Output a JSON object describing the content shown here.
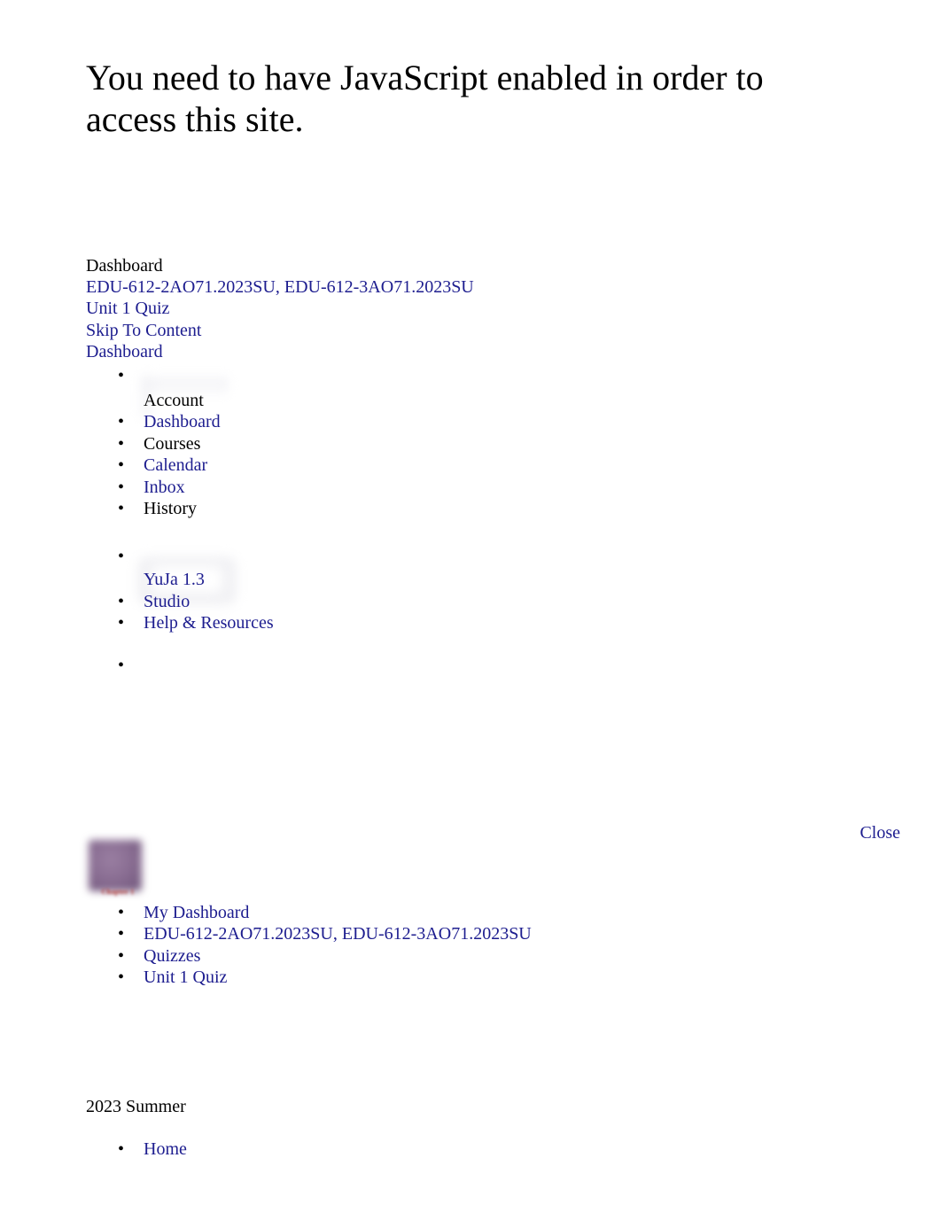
{
  "noscript": {
    "message": "You need to have JavaScript enabled in order to access this site."
  },
  "top_links": {
    "page_label": "Dashboard",
    "course_link": "EDU-612-2AO71.2023SU, EDU-612-3AO71.2023SU",
    "quiz_link": "Unit 1 Quiz",
    "skip_to_content": "Skip To Content",
    "dashboard_link": "Dashboard"
  },
  "global_nav": {
    "items": [
      {
        "label": "Account",
        "is_link": false,
        "has_image": true,
        "image": "account-avatar-placeholder"
      },
      {
        "label": "Dashboard",
        "is_link": true,
        "has_image": false
      },
      {
        "label": "Courses",
        "is_link": false,
        "has_image": false
      },
      {
        "label": "Calendar",
        "is_link": true,
        "has_image": false
      },
      {
        "label": "Inbox",
        "is_link": true,
        "has_image": false
      },
      {
        "label": "History",
        "is_link": false,
        "has_image": false
      },
      {
        "label": "YuJa 1.3",
        "is_link": true,
        "has_image": true,
        "image": "yuja-logo-placeholder"
      },
      {
        "label": "Studio",
        "is_link": true,
        "has_image": false
      },
      {
        "label": "Help & Resources",
        "is_link": true,
        "has_image": false
      },
      {
        "label": "",
        "is_link": false,
        "has_image": false
      }
    ]
  },
  "tray": {
    "close_label": "Close"
  },
  "course_card": {
    "thumbnail_caption": "Chapter 1",
    "thumbnail_color": "#8a6e93",
    "caption_color": "#b3322b"
  },
  "breadcrumb": {
    "items": [
      "My Dashboard",
      "EDU-612-2AO71.2023SU, EDU-612-3AO71.2023SU",
      "Quizzes",
      "Unit 1 Quiz"
    ]
  },
  "course_context": {
    "term": "2023 Summer",
    "nav_items": [
      "Home"
    ]
  },
  "colors": {
    "link": "#1d1d8f",
    "text": "#000000",
    "background": "#ffffff"
  }
}
